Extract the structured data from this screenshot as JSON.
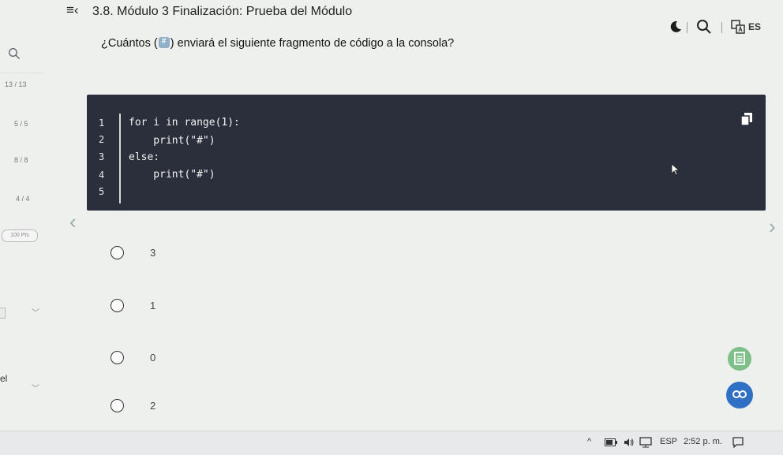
{
  "header": {
    "menu_icon": "≡‹",
    "title": "3.8. Módulo 3 Finalización: Prueba del Módulo",
    "lang": "ES"
  },
  "question": {
    "before": "¿Cuántos (",
    "after": ") enviará el siguiente fragmento de código a la consola?"
  },
  "sidebar": {
    "items": [
      "13 / 13",
      "5 / 5",
      "8 / 8",
      "4 / 4"
    ],
    "points_badge": "100 Pts",
    "letter": "el"
  },
  "code": {
    "line_numbers": [
      "1",
      "2",
      "3",
      "4",
      "5"
    ],
    "lines": [
      "for i in range(1):",
      "    print(\"#\")",
      "else:",
      "    print(\"#\")",
      ""
    ]
  },
  "options": [
    {
      "label": "3",
      "selected": false
    },
    {
      "label": "1",
      "selected": false
    },
    {
      "label": "0",
      "selected": false
    },
    {
      "label": "2",
      "selected": false
    }
  ],
  "taskbar": {
    "chevron": "^",
    "lang": "ESP",
    "time": "2:52 p. m."
  },
  "colors": {
    "code_bg": "#2b2f3b",
    "page_bg": "#eef0ee",
    "fab_green": "#7fc08a",
    "fab_blue": "#2f6fc4"
  },
  "icons": [
    "menu-icon",
    "moon-icon",
    "search-icon",
    "translate-icon",
    "copy-icon",
    "cursor-icon",
    "chevron-left-icon",
    "chevron-right-icon",
    "notes-icon",
    "chat-icon"
  ]
}
